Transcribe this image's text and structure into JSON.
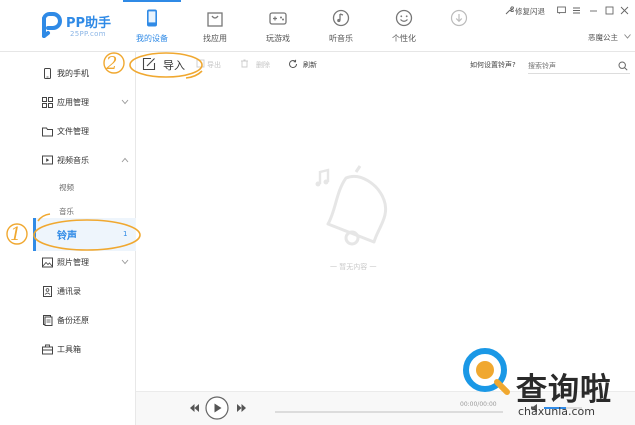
{
  "app": {
    "name": "PP助手",
    "url": "25PP.com"
  },
  "nav": [
    {
      "label": "我的设备",
      "icon": "phone-icon",
      "active": true
    },
    {
      "label": "找应用",
      "icon": "bag-icon"
    },
    {
      "label": "玩游戏",
      "icon": "gamepad-icon"
    },
    {
      "label": "听音乐",
      "icon": "music-disc-icon"
    },
    {
      "label": "个性化",
      "icon": "smiley-icon"
    },
    {
      "label": "",
      "icon": "download-icon"
    }
  ],
  "topright": {
    "repair": "修复闪退",
    "user": "恶魔公主"
  },
  "toolbar": {
    "import": "导入",
    "export": "导出",
    "delete": "删除",
    "refresh": "刷新",
    "help_link": "如何设置铃声?",
    "search_placeholder": "搜索铃声"
  },
  "sidebar": {
    "items": [
      {
        "label": "我的手机",
        "icon": "phone-icon"
      },
      {
        "label": "应用管理",
        "icon": "grid-icon",
        "expandable": true
      },
      {
        "label": "文件管理",
        "icon": "folder-icon"
      },
      {
        "label": "视频音乐",
        "icon": "video-icon",
        "expandable": true,
        "expanded": true
      },
      {
        "label": "照片管理",
        "icon": "photo-icon",
        "expandable": true
      },
      {
        "label": "通讯录",
        "icon": "contacts-icon"
      },
      {
        "label": "备份还原",
        "icon": "backup-icon"
      },
      {
        "label": "工具箱",
        "icon": "toolbox-icon"
      }
    ],
    "sub_items": [
      {
        "label": "视频"
      },
      {
        "label": "音乐"
      },
      {
        "label": "铃声",
        "badge": "1",
        "active": true
      }
    ]
  },
  "content": {
    "empty_text": "一 暂无内容 一"
  },
  "player": {
    "timecode": "00:00/00:00"
  },
  "annotations": {
    "step1": "1",
    "step2": "2"
  },
  "watermark": {
    "text": "查询啦",
    "url": "chaxunla.com"
  },
  "colors": {
    "accent": "#2f8ae6",
    "annotation": "#f0a830",
    "watermark_blue": "#1a98e6"
  }
}
